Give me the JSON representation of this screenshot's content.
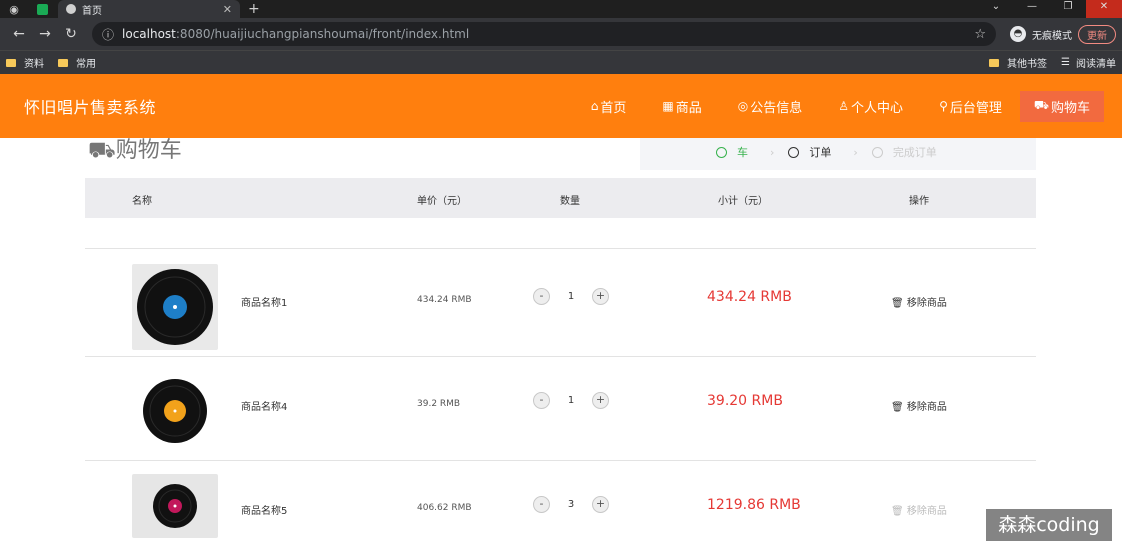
{
  "browser": {
    "tab_title": "首页",
    "url_host": "localhost",
    "url_rest": ":8080/huaijiuchangpianshoumai/front/index.html",
    "incognito_label": "无痕模式",
    "update_label": "更新",
    "bookmarks": [
      "资料",
      "常用"
    ],
    "bookmarks_right": [
      "其他书签",
      "阅读清单"
    ]
  },
  "site": {
    "title": "怀旧唱片售卖系统",
    "nav": [
      {
        "label": "首页",
        "icon": "home-icon"
      },
      {
        "label": "商品",
        "icon": "grid-icon"
      },
      {
        "label": "公告信息",
        "icon": "notice-icon"
      },
      {
        "label": "个人中心",
        "icon": "user-icon"
      },
      {
        "label": "后台管理",
        "icon": "link-icon"
      },
      {
        "label": "购物车",
        "icon": "cart-icon"
      }
    ]
  },
  "cart": {
    "title": "购物车",
    "steps": [
      "车",
      "订单",
      "完成订单"
    ],
    "headers": {
      "name": "名称",
      "price": "单价（元）",
      "qty": "数量",
      "subtotal": "小计（元）",
      "action": "操作"
    },
    "items": [
      {
        "name": "商品名称1",
        "price": "434.24 RMB",
        "qty": "1",
        "subtotal": "434.24 RMB",
        "remove": "移除商品",
        "label_color": "#1e7fc8"
      },
      {
        "name": "商品名称4",
        "price": "39.2 RMB",
        "qty": "1",
        "subtotal": "39.20 RMB",
        "remove": "移除商品",
        "label_color": "#f2a21b"
      },
      {
        "name": "商品名称5",
        "price": "406.62 RMB",
        "qty": "3",
        "subtotal": "1219.86 RMB",
        "remove": "移除商品",
        "label_color": "#c2185b"
      }
    ]
  },
  "watermark": "森森coding",
  "colors": {
    "header": "#ff7f0e",
    "active_nav": "#f26a3f",
    "subtotal": "#e53935"
  }
}
